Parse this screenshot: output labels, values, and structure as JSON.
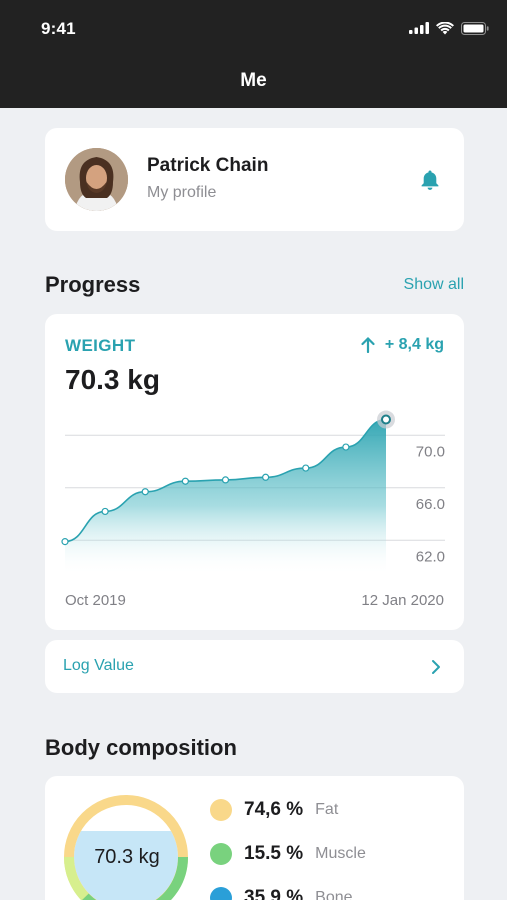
{
  "status_bar": {
    "time": "9:41"
  },
  "nav": {
    "title": "Me"
  },
  "profile": {
    "name": "Patrick Chain",
    "subtitle": "My profile"
  },
  "progress": {
    "title": "Progress",
    "show_all": "Show all"
  },
  "weight": {
    "label": "WEIGHT",
    "change": "+ 8,4 kg",
    "value": "70.3 kg",
    "x_start": "Oct 2019",
    "x_end": "12 Jan 2020",
    "y_ticks": [
      "70.0",
      "66.0",
      "62.0"
    ]
  },
  "chart_data": {
    "type": "area",
    "title": "WEIGHT",
    "x": [
      "Oct 2019",
      "",
      "",
      "",
      "",
      "",
      "",
      "",
      "12 Jan 2020"
    ],
    "values": [
      61.9,
      64.2,
      65.7,
      66.5,
      66.6,
      66.8,
      67.5,
      69.1,
      71.2
    ],
    "ylim": [
      60.5,
      72.0
    ],
    "y_ticks": [
      70.0,
      66.0,
      62.0
    ],
    "grid": true,
    "color": "#2aa2b0"
  },
  "log": {
    "label": "Log Value"
  },
  "body": {
    "title": "Body composition",
    "value": "70.3 kg",
    "items": [
      {
        "value": "74,6 %",
        "name": "Fat",
        "color": "#f9d88a"
      },
      {
        "value": "15.5 %",
        "name": "Muscle",
        "color": "#79d27e"
      },
      {
        "value": "35.9 %",
        "name": "Bone",
        "color": "#2a9fd8"
      }
    ]
  },
  "colors": {
    "accent": "#2aa2b0",
    "header": "#222222",
    "background": "#eef0f3"
  }
}
